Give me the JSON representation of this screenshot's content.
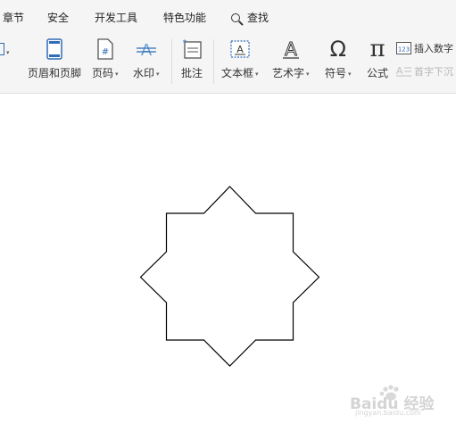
{
  "ribbon": {
    "tabs": [
      {
        "label": "章节"
      },
      {
        "label": "安全"
      },
      {
        "label": "开发工具"
      },
      {
        "label": "特色功能"
      },
      {
        "label": "查找"
      }
    ],
    "tools": [
      {
        "label": "页眉和页脚",
        "icon": "header-footer-icon",
        "dropdown": false
      },
      {
        "label": "页码",
        "icon": "page-number-icon",
        "dropdown": true
      },
      {
        "label": "水印",
        "icon": "watermark-icon",
        "dropdown": true
      },
      {
        "label": "批注",
        "icon": "comment-icon",
        "dropdown": false
      },
      {
        "label": "文本框",
        "icon": "text-box-icon",
        "dropdown": true
      },
      {
        "label": "艺术字",
        "icon": "word-art-icon",
        "dropdown": true
      },
      {
        "label": "符号",
        "icon": "omega-symbol-icon",
        "dropdown": true
      },
      {
        "label": "公式",
        "icon": "pi-formula-icon",
        "dropdown": false
      }
    ],
    "small_tools": [
      {
        "label": "插入数字",
        "icon": "insert-number-icon",
        "enabled": true
      },
      {
        "label": "首字下沉",
        "icon": "drop-cap-icon",
        "enabled": false
      }
    ],
    "number_icon_text": "123",
    "page_number_icon_text": "#"
  },
  "document": {
    "shape": "eight-point-star",
    "shape_stroke": "#000000",
    "shape_fill": "#ffffff"
  },
  "watermark": {
    "text": "Baidu 经验",
    "url": "jingyan.baidu.com"
  },
  "colors": {
    "ribbon_bg": "#f5f5f5",
    "icon_blue": "#2f6db5",
    "disabled_text": "#b5b5b5"
  }
}
